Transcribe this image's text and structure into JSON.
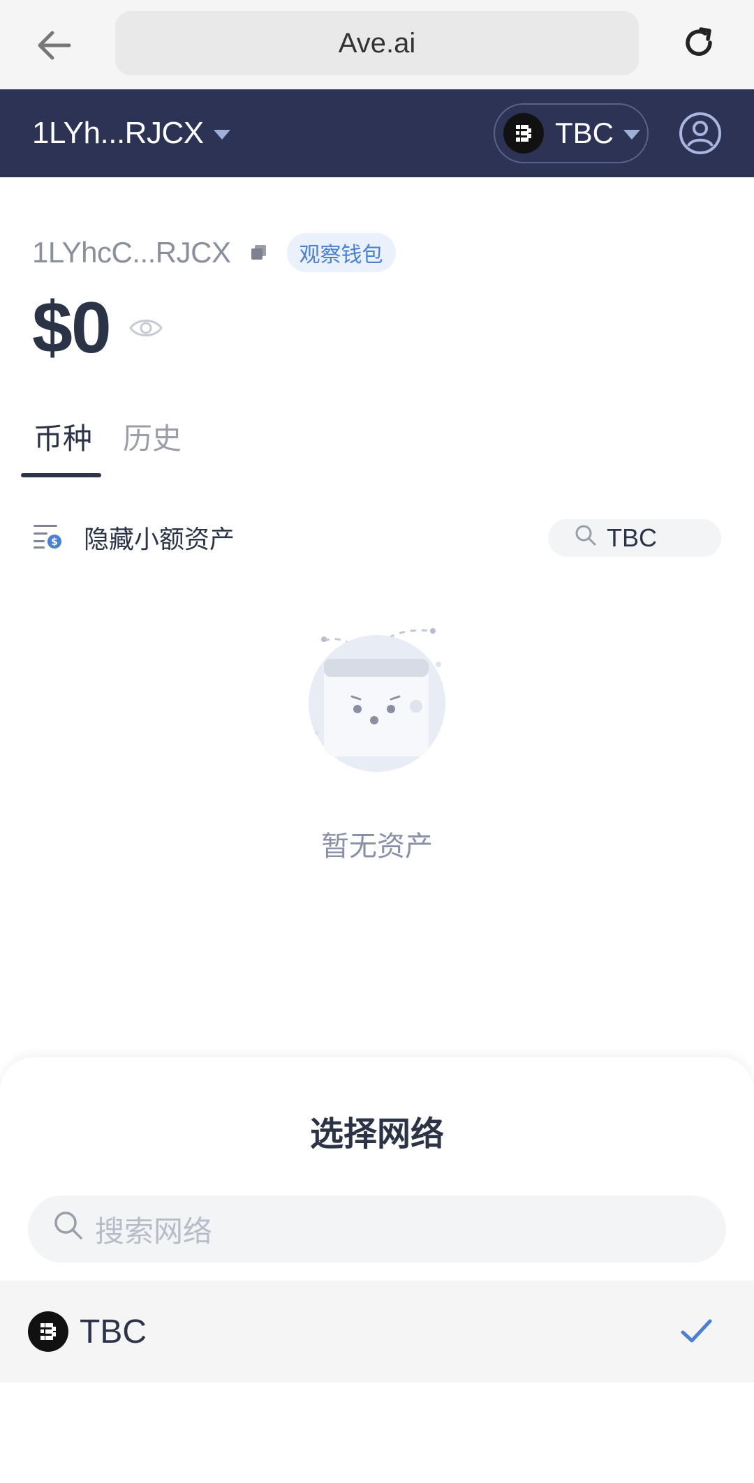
{
  "browser": {
    "url": "Ave.ai"
  },
  "header": {
    "wallet_short": "1LYh...RJCX",
    "chain": "TBC"
  },
  "wallet": {
    "address": "1LYhcC...RJCX",
    "badge": "观察钱包",
    "balance": "$0"
  },
  "tabs": [
    {
      "label": "币种",
      "active": true
    },
    {
      "label": "历史",
      "active": false
    }
  ],
  "filter": {
    "hide_small_label": "隐藏小额资产",
    "search_value": "TBC"
  },
  "empty": {
    "message": "暂无资产"
  },
  "sheet": {
    "title": "选择网络",
    "search_placeholder": "搜索网络",
    "networks": [
      {
        "label": "TBC",
        "selected": true
      }
    ]
  },
  "colors": {
    "header_bg": "#2c3354",
    "accent": "#4a7fd1",
    "text_primary": "#2b3347"
  }
}
